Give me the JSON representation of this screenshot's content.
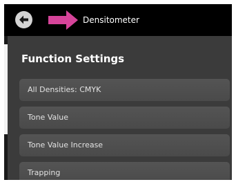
{
  "header": {
    "title": "Densitometer",
    "back_icon": "back-arrow-icon",
    "accent_arrow_icon": "pink-arrow-icon",
    "accent_color": "#d6449a"
  },
  "main": {
    "section_title": "Function Settings",
    "items": [
      {
        "label": "All Densities: CMYK"
      },
      {
        "label": "Tone Value"
      },
      {
        "label": "Tone Value Increase"
      },
      {
        "label": "Trapping"
      }
    ]
  }
}
